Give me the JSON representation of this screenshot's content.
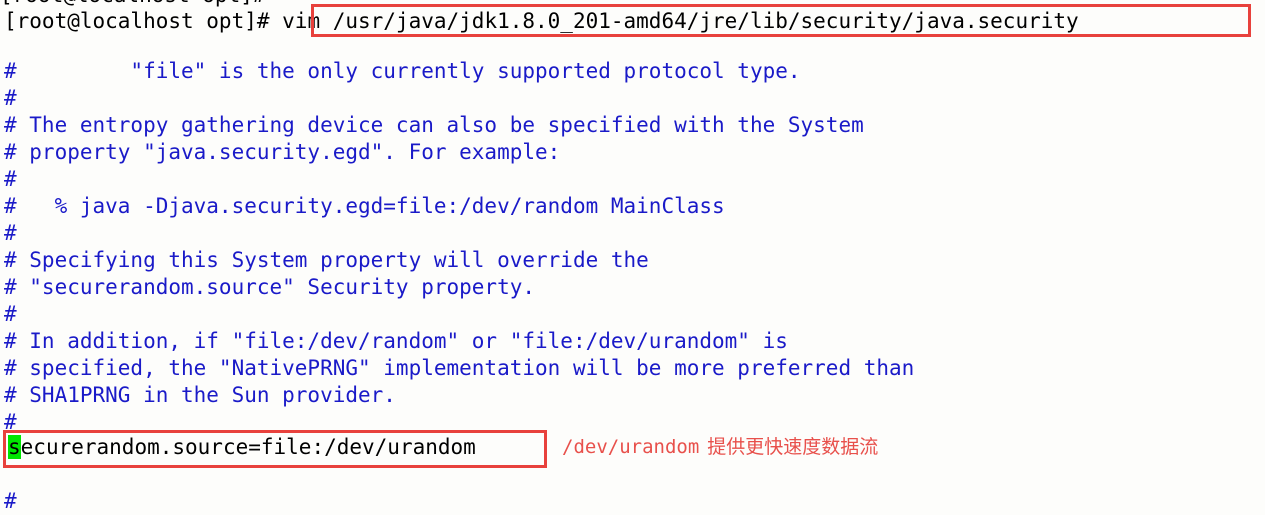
{
  "terminal": {
    "background_color": "#fdfdfb",
    "comment_color": "#1a1ac8",
    "text_color": "#000000",
    "annotation_color": "#e8504b",
    "highlight_box_color": "#e8413c",
    "cursor_color": "#00e500",
    "clipped_top_line": "[root@localhost opt]#",
    "prompt": "[root@localhost opt]# ",
    "command": "vim /usr/java/jdk1.8.0_201-amd64/jre/lib/security/java.security",
    "lines": [
      {
        "id": "line-file-protocol",
        "text": "#         \"file\" is the only currently supported protocol type.",
        "kind": "comment"
      },
      {
        "id": "line-blank-1",
        "text": "#",
        "kind": "comment"
      },
      {
        "id": "line-entropy-1",
        "text": "# The entropy gathering device can also be specified with the System",
        "kind": "comment"
      },
      {
        "id": "line-entropy-2",
        "text": "# property \"java.security.egd\". For example:",
        "kind": "comment"
      },
      {
        "id": "line-blank-2",
        "text": "#",
        "kind": "comment"
      },
      {
        "id": "line-example-cmd",
        "text": "#   % java -Djava.security.egd=file:/dev/random MainClass",
        "kind": "comment"
      },
      {
        "id": "line-blank-3",
        "text": "#",
        "kind": "comment"
      },
      {
        "id": "line-override-1",
        "text": "# Specifying this System property will override the",
        "kind": "comment"
      },
      {
        "id": "line-override-2",
        "text": "# \"securerandom.source\" Security property.",
        "kind": "comment"
      },
      {
        "id": "line-blank-4",
        "text": "#",
        "kind": "comment"
      },
      {
        "id": "line-addition-1",
        "text": "# In addition, if \"file:/dev/random\" or \"file:/dev/urandom\" is",
        "kind": "comment"
      },
      {
        "id": "line-addition-2",
        "text": "# specified, the \"NativePRNG\" implementation will be more preferred than",
        "kind": "comment"
      },
      {
        "id": "line-addition-3",
        "text": "# SHA1PRNG in the Sun provider.",
        "kind": "comment"
      },
      {
        "id": "line-blank-5",
        "text": "#",
        "kind": "comment"
      }
    ],
    "setting_line": {
      "cursor_char": "s",
      "rest": "ecurerandom.source=file:/dev/urandom",
      "full_text": "securerandom.source=file:/dev/urandom"
    },
    "trailing_line": "#",
    "annotation": {
      "path": "/dev/urandom",
      "note": "提供更快速度数据流"
    }
  }
}
